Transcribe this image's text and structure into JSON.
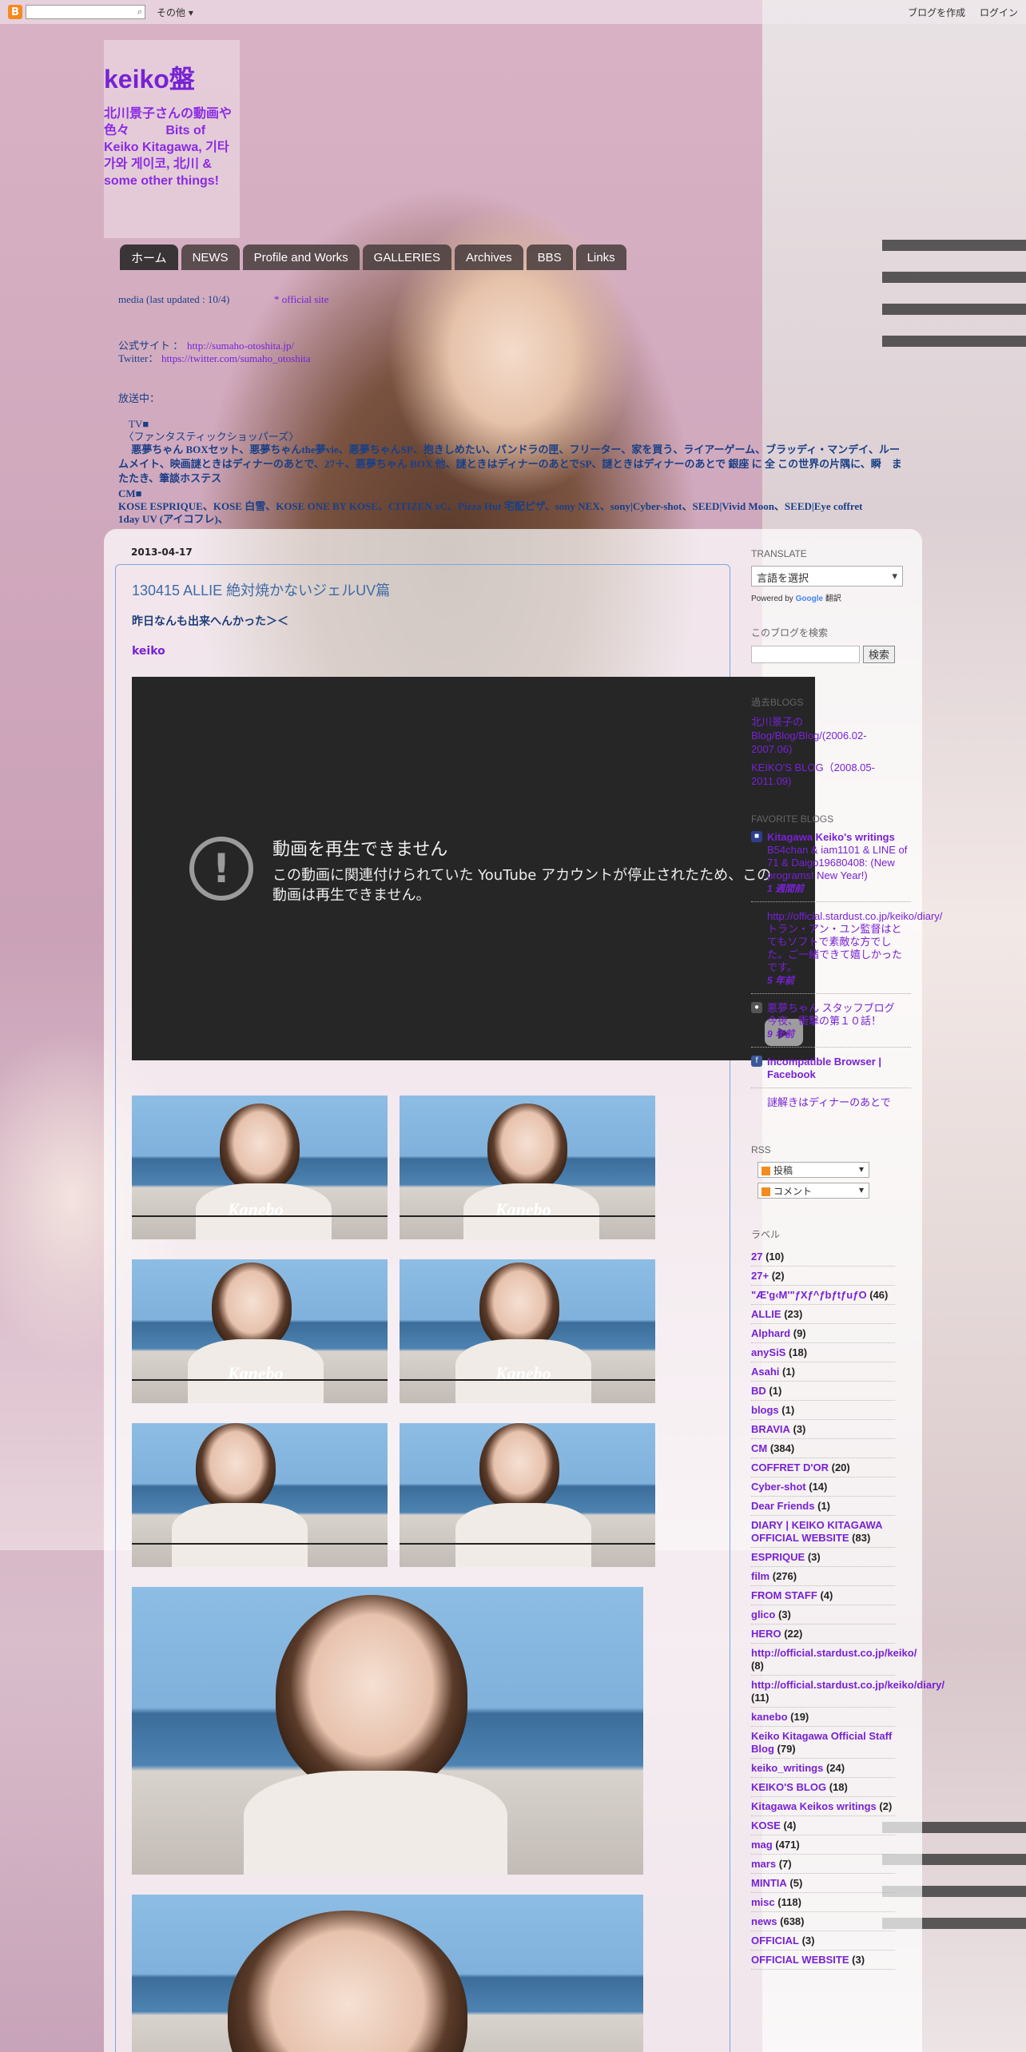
{
  "navbar": {
    "search_placeholder": "",
    "more_label": "その他",
    "create_blog": "ブログを作成",
    "login": "ログイン"
  },
  "header": {
    "title": "keiko盤",
    "description": "北川景子さんの動画や色々 　 　 Bits of Keiko Kitagawa, 기타가와 게이코, 北川 & some other things!"
  },
  "tabs": [
    "ホーム",
    "NEWS",
    "Profile and Works",
    "GALLERIES",
    "Archives",
    "BBS",
    "Links"
  ],
  "crossbar": {
    "line1a": "media (last updated : 10/4)",
    "line1b": "* official site",
    "line2_label": "公式サイト ：",
    "line2_link": "http://sumaho-otoshita.jp/",
    "line3_label": "Twitter：",
    "line3_link": "https://twitter.com/sumaho_otoshita",
    "line4": "放送中：",
    "line5": "　TV■",
    "line6": "　〈ファンタスティックショッパーズ〉",
    "line7": "　  悪夢ちゃん BOXセット、悪夢ちゃんthe夢vie、悪夢ちゃんSP、抱きしめたい、パンドラの匣、フリーター、家を買う、ライアーゲーム、ブラッディ・マンデイ、ルームメイト、映画謎ときはディナーのあとで、27＋、悪夢ちゃん BOX 他、謎ときはディナーのあとでSP、謎ときはディナーのあとで 銀座 に 全 この世界の片隅に、瞬　またたき、筆談ホステス",
    "line8": "CM■",
    "line9": "KOSE ESPRIQUE、KOSE 白雪、KOSE ONE BY KOSE、CITIZEN xC、Pizza Hut 宅配ピザ、sony NEX、sony|Cyber-shot、SEED|Vivid Moon、SEED|Eye coffret",
    "line10": "1day UV (アイコフレ)、"
  },
  "post": {
    "date": "2013-04-17",
    "title": "130415 ALLIE 絶対焼かないジェルUV篇",
    "subtitle": "昨日なんも出来へんかった＞＜",
    "author": "keiko",
    "video": {
      "error_title": "動画を再生できません",
      "error_message": "この動画に関連付けられていた YouTube アカウントが停止されたため、この動画は再生できません。"
    },
    "thumb_brand": "Kanebo"
  },
  "sidebar": {
    "translate": {
      "heading": "TRANSLATE",
      "select_label": "言語を選択",
      "powered": "Powered by",
      "google": "Google",
      "translate_word": "翻訳"
    },
    "search": {
      "heading": "このブログを検索",
      "button": "検索"
    },
    "past_blogs": {
      "heading": "過去BLOGS",
      "items": [
        "北川景子のBlog/Blog/Blog/(2006.02-2007.06)",
        "KEIKO'S BLOG（2008.05-2011.09)"
      ]
    },
    "favorite_blogs": {
      "heading": "FAVORITE BLOGS",
      "items": [
        {
          "title": "Kitagawa Keiko's writings",
          "snippet": "B54chan & iam1101 & LINE of 71 & Daigo19680408: (New programs! New Year!)",
          "age": "1 週間前"
        },
        {
          "title": "",
          "snippet": "http://official.stardust.co.jp/keiko/diary/ トラン・アン・ユン監督はとてもソフトで素敵な方でした。ご一緒できて嬉しかったです。",
          "age": "5 年前"
        },
        {
          "title": "悪夢ちゃん スタッフブログ",
          "snippet": "今夜、衝撃の第１０話！",
          "age": "9 年前"
        },
        {
          "title": "Incompatible Browser | Facebook",
          "snippet": "",
          "age": ""
        },
        {
          "title": "",
          "snippet": "謎解きはディナーのあとで",
          "age": ""
        }
      ]
    },
    "rss": {
      "heading": "RSS",
      "posts": "投稿",
      "comments": "コメント"
    },
    "labels": {
      "heading": "ラベル",
      "items": [
        {
          "name": "27",
          "count": "(10)"
        },
        {
          "name": "27+",
          "count": "(2)"
        },
        {
          "name": "\"Æ'g‹M'\"ƒXƒ^ƒbƒtƒuƒO",
          "count": "(46)"
        },
        {
          "name": "ALLIE",
          "count": "(23)"
        },
        {
          "name": "Alphard",
          "count": "(9)"
        },
        {
          "name": "anySiS",
          "count": "(18)"
        },
        {
          "name": "Asahi",
          "count": "(1)"
        },
        {
          "name": "BD",
          "count": "(1)"
        },
        {
          "name": "blogs",
          "count": "(1)"
        },
        {
          "name": "BRAVIA",
          "count": "(3)"
        },
        {
          "name": "CM",
          "count": "(384)"
        },
        {
          "name": "COFFRET D'OR",
          "count": "(20)"
        },
        {
          "name": "Cyber-shot",
          "count": "(14)"
        },
        {
          "name": "Dear Friends",
          "count": "(1)"
        },
        {
          "name": "DIARY | KEIKO KITAGAWA OFFICIAL WEBSITE",
          "count": "(83)"
        },
        {
          "name": "ESPRIQUE",
          "count": "(3)"
        },
        {
          "name": "film",
          "count": "(276)"
        },
        {
          "name": "FROM STAFF",
          "count": "(4)"
        },
        {
          "name": "glico",
          "count": "(3)"
        },
        {
          "name": "HERO",
          "count": "(22)"
        },
        {
          "name": "http://official.stardust.co.jp/keiko/",
          "count": "(8)"
        },
        {
          "name": "http://official.stardust.co.jp/keiko/diary/",
          "count": "(11)"
        },
        {
          "name": "kanebo",
          "count": "(19)"
        },
        {
          "name": "Keiko Kitagawa Official Staff Blog",
          "count": "(79)"
        },
        {
          "name": "keiko_writings",
          "count": "(24)"
        },
        {
          "name": "KEIKO'S BLOG",
          "count": "(18)"
        },
        {
          "name": "Kitagawa Keikos writings",
          "count": "(2)"
        },
        {
          "name": "KOSE",
          "count": "(4)"
        },
        {
          "name": "mag",
          "count": "(471)"
        },
        {
          "name": "mars",
          "count": "(7)"
        },
        {
          "name": "MINTIA",
          "count": "(5)"
        },
        {
          "name": "misc",
          "count": "(118)"
        },
        {
          "name": "news",
          "count": "(638)"
        },
        {
          "name": "OFFICIAL",
          "count": "(3)"
        },
        {
          "name": "OFFICIAL WEBSITE",
          "count": "(3)"
        }
      ]
    }
  },
  "colors": {
    "accent_purple": "#7722d4",
    "post_title_blue": "#3e6aa6",
    "post_border": "#7fa6d8",
    "video_bg": "#262626",
    "tab_bg": "#463c3c"
  }
}
